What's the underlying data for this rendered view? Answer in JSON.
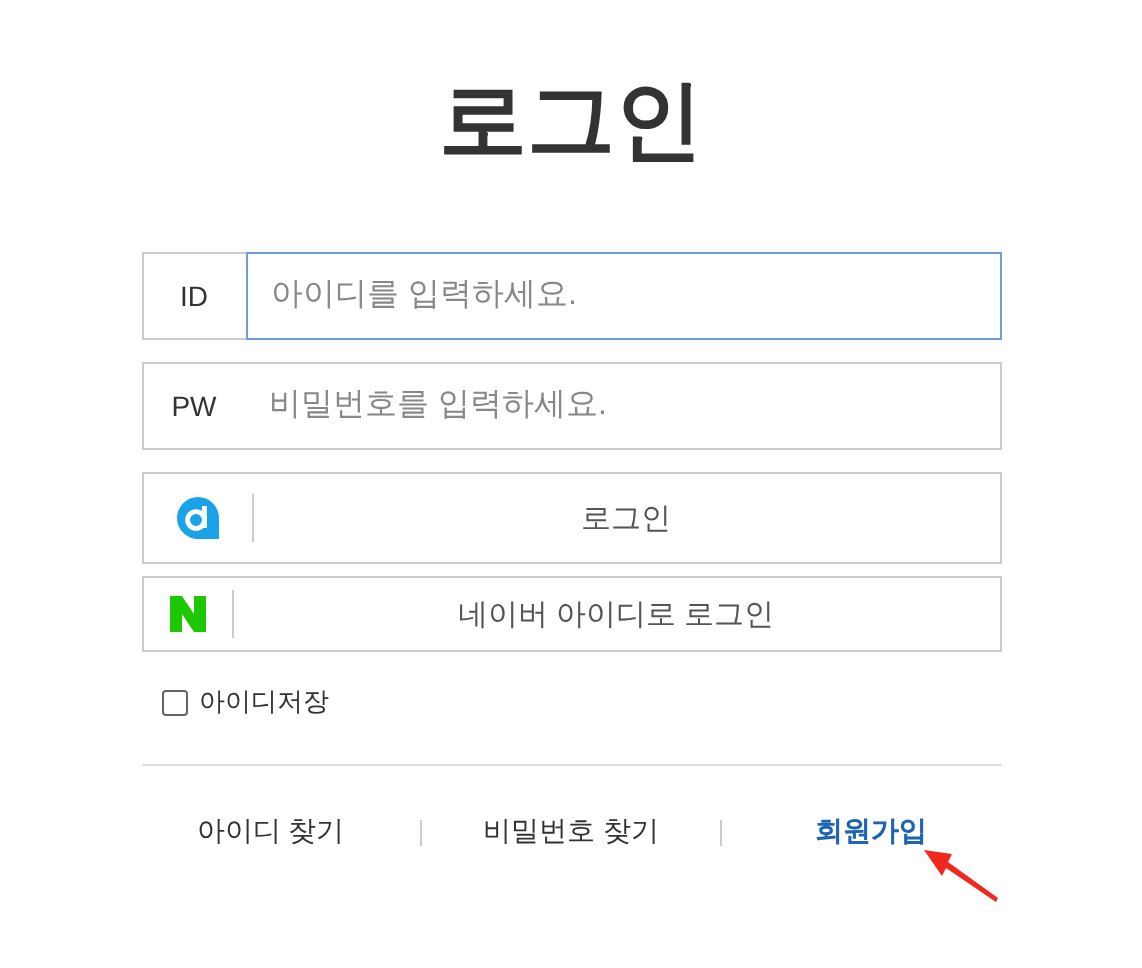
{
  "title": "로그인",
  "fields": [
    {
      "label": "ID",
      "placeholder": "아이디를 입력하세요.",
      "focused": true
    },
    {
      "label": "PW",
      "placeholder": "비밀번호를 입력하세요.",
      "focused": false
    }
  ],
  "login_buttons": [
    {
      "kind": "daum",
      "label": "로그인"
    },
    {
      "kind": "naver",
      "label": "네이버 아이디로 로그인"
    }
  ],
  "remember": {
    "label": "아이디저장",
    "checked": false
  },
  "links": [
    {
      "label": "아이디 찾기",
      "highlighted": false
    },
    {
      "label": "비밀번호 찾기",
      "highlighted": false
    },
    {
      "label": "회원가입",
      "highlighted": true
    }
  ]
}
